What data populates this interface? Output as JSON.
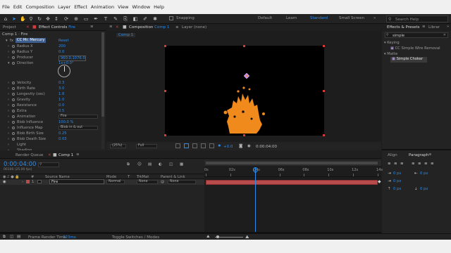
{
  "menu": [
    "File",
    "Edit",
    "Composition",
    "Layer",
    "Effect",
    "Animation",
    "View",
    "Window",
    "Help"
  ],
  "toolbar": {
    "snapping": "Snapping",
    "workspaces": [
      "Default",
      "Learn",
      "Standard",
      "Small Screen"
    ],
    "active_workspace": "Standard",
    "search_placeholder": "Search Help"
  },
  "left_panel": {
    "tab_project": "Project",
    "tab_effect_controls": "Effect Controls",
    "layer_name": "Fire",
    "breadcrumb": "Comp 1 · Fire",
    "effect_name": "CC Mr. Mercury",
    "reset": "Reset",
    "properties": [
      {
        "name": "Radius X",
        "value": "200"
      },
      {
        "name": "Radius Y",
        "value": "0.0"
      },
      {
        "name": "Producer",
        "value": "960.0,1076.0"
      },
      {
        "name": "Direction",
        "value": "1x+0.0°"
      },
      {
        "name": "Velocity",
        "value": "0.3"
      },
      {
        "name": "Birth Rate",
        "value": "3.0"
      },
      {
        "name": "Longevity (sec)",
        "value": "1.8"
      },
      {
        "name": "Gravity",
        "value": "1.0"
      },
      {
        "name": "Resistance",
        "value": "0.0"
      },
      {
        "name": "Extra",
        "value": "0.5"
      },
      {
        "name": "Animation",
        "value": "Fire"
      },
      {
        "name": "Blob Influence",
        "value": "100.0 %"
      },
      {
        "name": "Influence Map",
        "value": "Blob in & out"
      },
      {
        "name": "Blob Birth Size",
        "value": "0.25"
      },
      {
        "name": "Blob Death Size",
        "value": "0.03"
      },
      {
        "name": "Light",
        "value": ""
      },
      {
        "name": "Shading",
        "value": ""
      }
    ]
  },
  "comp_panel": {
    "tab": "Composition",
    "comp_name": "Comp 1",
    "layer_tab": "Layer  (none)",
    "sub_tab": "Comp 1",
    "zoom": "(25%)",
    "resolution": "Full",
    "exposure": "+0.0",
    "timecode": "0:00:04:00"
  },
  "right_panel": {
    "tab_effects": "Effects & Presets",
    "tab_libraries": "Librar",
    "search_value": "simple",
    "categories": [
      {
        "name": "Keying",
        "items": [
          "CC Simple Wire Removal"
        ]
      },
      {
        "name": "Matte",
        "items": [
          "Simple Choker"
        ]
      }
    ],
    "selected_item": "Simple Choker",
    "tab_align": "Align",
    "tab_paragraph": "Paragraph",
    "para_values": [
      "0 px",
      "0 px",
      "0 px",
      "0 px",
      "0 px"
    ]
  },
  "timeline": {
    "tab_render": "Render Queue",
    "tab_comp": "Comp 1",
    "timecode": "0:00:04:00",
    "sub_timecode": "00100 (25.00 fps)",
    "columns": [
      "#",
      "Source Name",
      "Mode",
      "T",
      "TrkMat",
      "Parent & Link"
    ],
    "layer": {
      "num": "1",
      "name": "Fire",
      "mode": "Normal",
      "trkmat": "None",
      "parent": "None"
    },
    "ruler": [
      "0s",
      "02s",
      "04s",
      "06s",
      "08s",
      "10s",
      "12s",
      "14s"
    ],
    "playhead_seconds": 4,
    "duration_seconds": 14,
    "render_time_label": "Frame Render Time",
    "render_time_value": "323ms",
    "toggle_label": "Toggle Switches / Modes"
  },
  "colors": {
    "accent": "#2d8ceb",
    "layer_bar": "#b84c4c",
    "fire": "#f08a1c",
    "background": "#1d1d1d"
  }
}
